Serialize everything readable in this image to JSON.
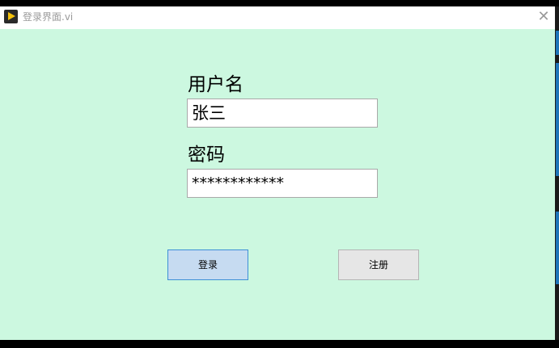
{
  "window": {
    "title": "登录界面.vi",
    "close_glyph": "✕",
    "background": "#ccf8e0"
  },
  "form": {
    "username_label": "用户名",
    "username_value": "张三",
    "password_label": "密码",
    "password_value": "************"
  },
  "buttons": {
    "login_label": "登录",
    "register_label": "注册"
  },
  "icons": {
    "app": "labview-run-arrow-icon",
    "close": "close-icon"
  },
  "colors": {
    "accent": "#3d8fd6",
    "login_fill": "#c6dbf1",
    "register_fill": "#e6e6e6"
  }
}
